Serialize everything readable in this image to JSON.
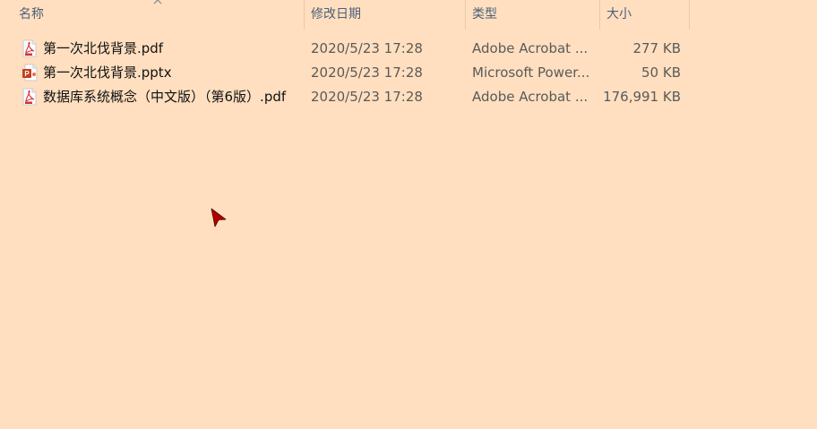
{
  "columns": {
    "name": "名称",
    "date": "修改日期",
    "type": "类型",
    "size": "大小"
  },
  "files": [
    {
      "name": "第一次北伐背景.pdf",
      "date": "2020/5/23 17:28",
      "type": "Adobe Acrobat ...",
      "size": "277 KB",
      "icon": "pdf-file-icon"
    },
    {
      "name": "第一次北伐背景.pptx",
      "date": "2020/5/23 17:28",
      "type": "Microsoft Power...",
      "size": "50 KB",
      "icon": "pptx-file-icon"
    },
    {
      "name": "数据库系统概念（中文版）（第6版）.pdf",
      "date": "2020/5/23 17:28",
      "type": "Adobe Acrobat ...",
      "size": "176,991 KB",
      "icon": "pdf-file-icon"
    }
  ],
  "colors": {
    "background": "#FFDFBF",
    "pdf_icon": "#d13438",
    "pptx_icon": "#c43e1c",
    "cursor": "#b00000"
  }
}
